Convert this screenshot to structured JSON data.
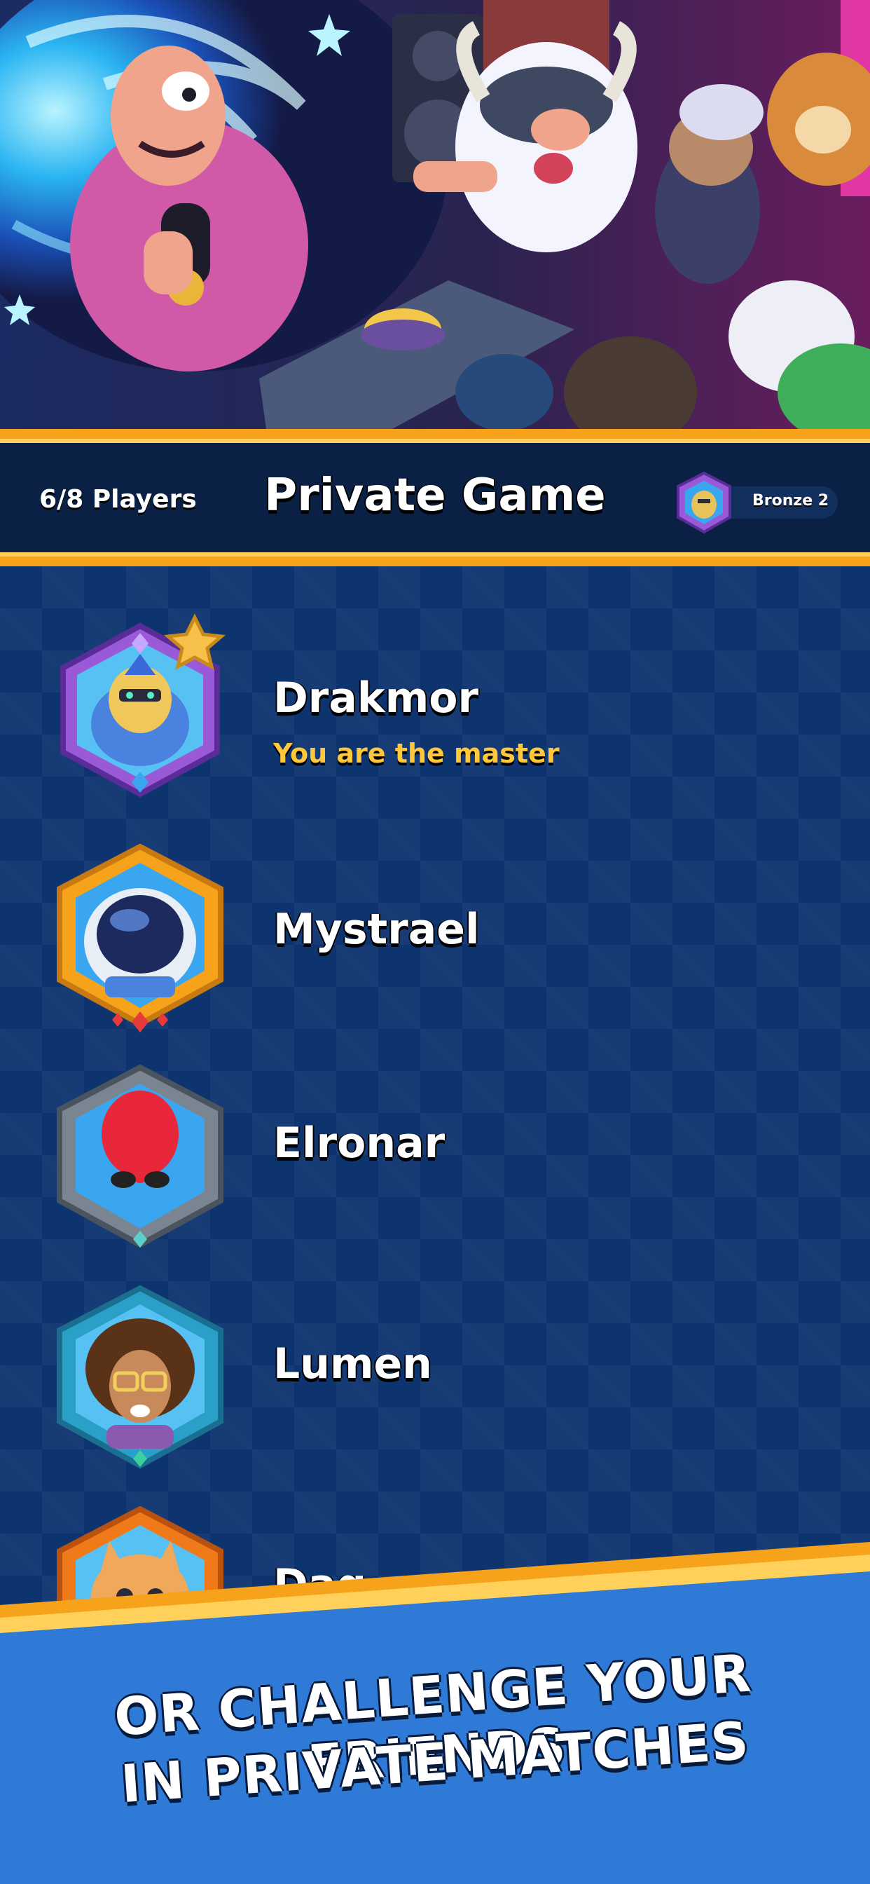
{
  "header": {
    "players_count": "6/8 Players",
    "title": "Private Game",
    "rank_label": "Bronze 2"
  },
  "players": [
    {
      "name": "Drakmor",
      "role": "You are the master",
      "avatar_icon": "armored-knight-avatar-icon",
      "frame_color": "#9a5ad8",
      "is_master": true
    },
    {
      "name": "Mystrael",
      "avatar_icon": "astronaut-avatar-icon",
      "frame_color": "#f6a21a"
    },
    {
      "name": "Elronar",
      "avatar_icon": "red-alien-avatar-icon",
      "frame_color": "#7a8591"
    },
    {
      "name": "Lumen",
      "avatar_icon": "curly-hair-person-avatar-icon",
      "frame_color": "#2aa0c8"
    },
    {
      "name": "Dag",
      "avatar_icon": "orange-cat-avatar-icon",
      "frame_color": "#f07a1a"
    }
  ],
  "banner": {
    "line1": "OR CHALLENGE YOUR FRIENDS",
    "line2": "IN PRIVATE MATCHES"
  },
  "colors": {
    "accent_gold": "#f6a21a",
    "header_bg": "#0a2044",
    "list_bg": "#0e3470",
    "banner_blue": "#2f7ad6",
    "master_text": "#ffc83a"
  },
  "icons": {
    "master_badge": "star-icon",
    "hero": "party-characters-illustration"
  }
}
